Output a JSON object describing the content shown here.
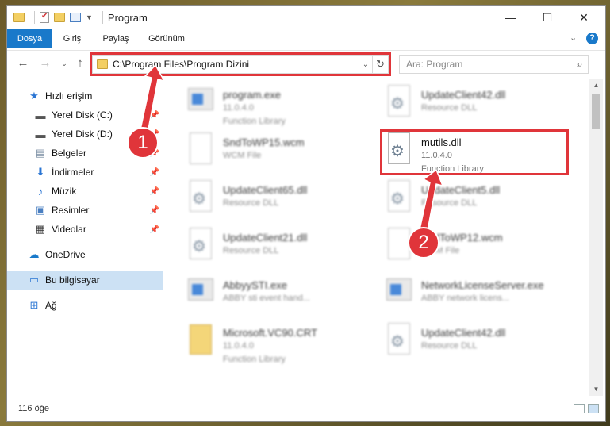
{
  "window": {
    "title": "Program"
  },
  "window_controls": {
    "minimize": "—",
    "maximize": "☐",
    "close": "✕"
  },
  "ribbon": {
    "tabs": [
      "Dosya",
      "Giriş",
      "Paylaş",
      "Görünüm"
    ],
    "active_tab": "Dosya",
    "help": "?"
  },
  "navigation": {
    "address_path": "C:\\Program Files\\Program Dizini",
    "search_placeholder": "Ara: Program"
  },
  "sidebar": {
    "items": [
      {
        "label": "Hızlı erişim",
        "icon": "star-icon"
      },
      {
        "label": "Yerel Disk (C:)",
        "icon": "drive-icon",
        "pinned": true
      },
      {
        "label": "Yerel Disk (D:)",
        "icon": "drive-icon",
        "pinned": true
      },
      {
        "label": "Belgeler",
        "icon": "documents-icon",
        "pinned": true
      },
      {
        "label": "İndirmeler",
        "icon": "download-icon",
        "pinned": true
      },
      {
        "label": "Müzik",
        "icon": "music-icon",
        "pinned": true
      },
      {
        "label": "Resimler",
        "icon": "pictures-icon",
        "pinned": true
      },
      {
        "label": "Videolar",
        "icon": "videos-icon",
        "pinned": true
      },
      {
        "label": "OneDrive",
        "icon": "cloud-icon"
      },
      {
        "label": "Bu bilgisayar",
        "icon": "computer-icon",
        "selected": true
      },
      {
        "label": "Ağ",
        "icon": "network-icon"
      }
    ]
  },
  "files": [
    {
      "name": "program.exe",
      "line2": "11.0.4.0",
      "line3": "Function Library",
      "icon": "exe-icon"
    },
    {
      "name": "UpdateClient42.dll",
      "line2": "Resource DLL",
      "line3": "",
      "icon": "dll-icon"
    },
    {
      "name": "SndToWP15.wcm",
      "line2": "WCM File",
      "line3": "",
      "icon": "file-icon"
    },
    {
      "name": "mutils.dll",
      "line2": "11.0.4.0",
      "line3": "Function Library",
      "icon": "dll-icon",
      "highlighted": true
    },
    {
      "name": "UpdateClient65.dll",
      "line2": "Resource DLL",
      "line3": "",
      "icon": "dll-icon"
    },
    {
      "name": "UpdateClient5.dll",
      "line2": "Resource DLL",
      "line3": "",
      "icon": "dll-icon"
    },
    {
      "name": "UpdateClient21.dll",
      "line2": "Resource DLL",
      "line3": "",
      "icon": "dll-icon"
    },
    {
      "name": "SndToWP12.wcm",
      "line2": "WCM File",
      "line3": "",
      "icon": "file-icon"
    },
    {
      "name": "AbbyySTI.exe",
      "line2": "ABBY sti event hand...",
      "line3": "",
      "icon": "app-icon"
    },
    {
      "name": "NetworkLicenseServer.exe",
      "line2": "ABBY network licens...",
      "line3": "",
      "icon": "app-icon"
    },
    {
      "name": "Microsoft.VC90.CRT",
      "line2": "11.0.4.0",
      "line3": "Function Library",
      "icon": "folder-icon"
    },
    {
      "name": "UpdateClient42.dll",
      "line2": "Resource DLL",
      "line3": "",
      "icon": "dll-icon"
    }
  ],
  "status": {
    "item_count": "116 öğe"
  },
  "annotations": {
    "badge1": "1",
    "badge2": "2",
    "accent_color": "#e0353a"
  }
}
